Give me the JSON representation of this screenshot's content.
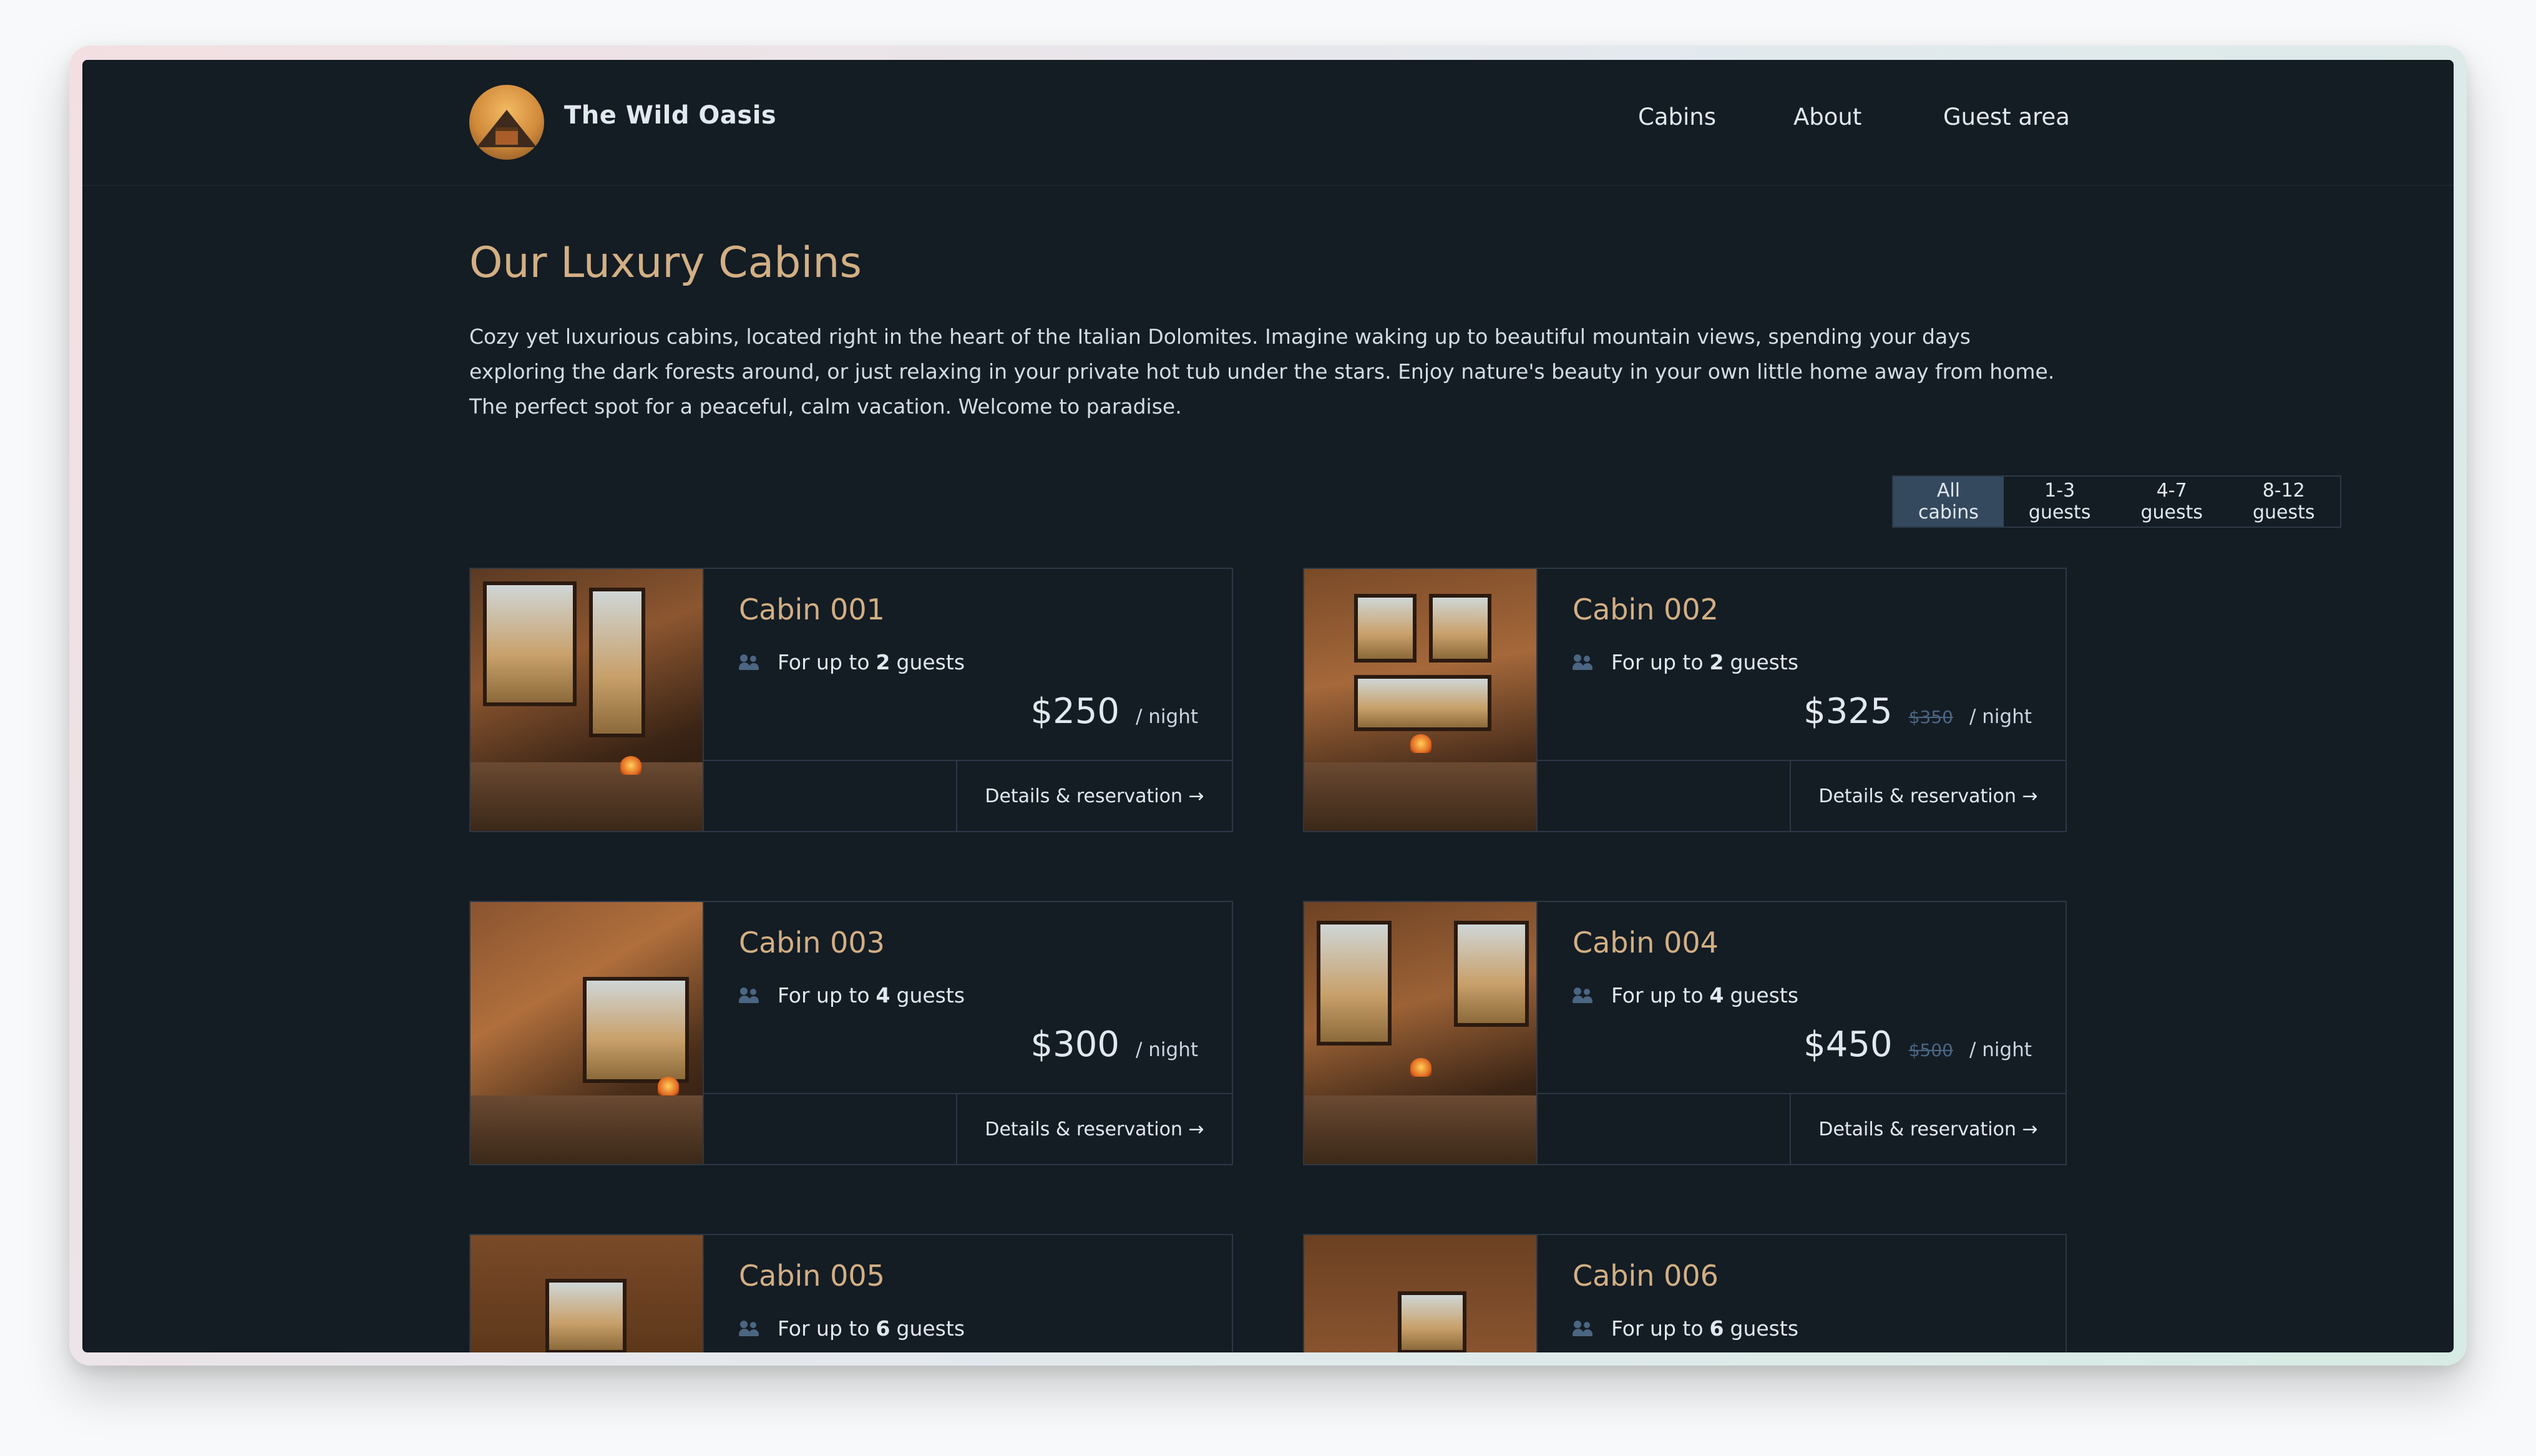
{
  "header": {
    "brand": "The Wild Oasis",
    "nav": [
      "Cabins",
      "About",
      "Guest area"
    ]
  },
  "page": {
    "title": "Our Luxury Cabins",
    "intro": "Cozy yet luxurious cabins, located right in the heart of the Italian Dolomites. Imagine waking up to beautiful mountain views, spending your days exploring the dark forests around, or just relaxing in your private hot tub under the stars. Enjoy nature's beauty in your own little home away from home. The perfect spot for a peaceful, calm vacation. Welcome to paradise."
  },
  "filter": {
    "options": [
      "All cabins",
      "1-3 guests",
      "4-7 guests",
      "8-12 guests"
    ],
    "selected": "All cabins"
  },
  "cabins": [
    {
      "name": "Cabin 001",
      "guests_prefix": "For up to",
      "guests": "2",
      "guests_suffix": "guests",
      "price": "$250",
      "old_price": "",
      "per_night": "/ night",
      "cta": "Details & reservation →"
    },
    {
      "name": "Cabin 002",
      "guests_prefix": "For up to",
      "guests": "2",
      "guests_suffix": "guests",
      "price": "$325",
      "old_price": "$350",
      "per_night": "/ night",
      "cta": "Details & reservation →"
    },
    {
      "name": "Cabin 003",
      "guests_prefix": "For up to",
      "guests": "4",
      "guests_suffix": "guests",
      "price": "$300",
      "old_price": "",
      "per_night": "/ night",
      "cta": "Details & reservation →"
    },
    {
      "name": "Cabin 004",
      "guests_prefix": "For up to",
      "guests": "4",
      "guests_suffix": "guests",
      "price": "$450",
      "old_price": "$500",
      "per_night": "/ night",
      "cta": "Details & reservation →"
    },
    {
      "name": "Cabin 005",
      "guests_prefix": "For up to",
      "guests": "6",
      "guests_suffix": "guests",
      "price": "",
      "old_price": "",
      "per_night": "",
      "cta": ""
    },
    {
      "name": "Cabin 006",
      "guests_prefix": "For up to",
      "guests": "6",
      "guests_suffix": "guests",
      "price": "",
      "old_price": "",
      "per_night": "",
      "cta": ""
    }
  ],
  "colors": {
    "background": "#141c24",
    "accent": "#d2af84",
    "border": "#2c3845",
    "filter_active": "#34495e",
    "icon": "#4b6682"
  }
}
